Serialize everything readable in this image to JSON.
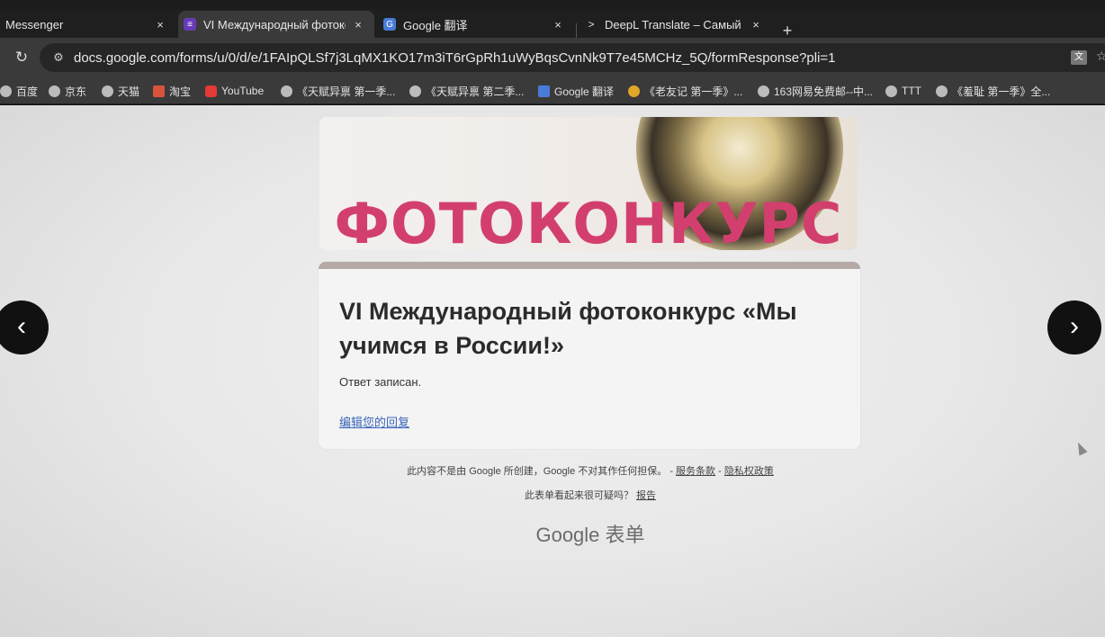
{
  "browser": {
    "tabs": [
      {
        "title": "Messenger",
        "close": "×"
      },
      {
        "title": "VI Международный фотоко",
        "close": "×",
        "active": true
      },
      {
        "title": "Google 翻译",
        "close": "×"
      },
      {
        "title": "DeepL Translate – Самый то",
        "close": "×"
      }
    ],
    "new_tab": "+",
    "url": "docs.google.com/forms/u/0/d/e/1FAIpQLSf7j3LqMX1KO17m3iT6rGpRh1uWyBqsCvnNk9T7e45MCHz_5Q/formResponse?pli=1",
    "bookmarks": [
      "百度",
      "京东",
      "天猫",
      "淘宝",
      "YouTube",
      "《天赋异禀 第一季...",
      "《天赋异禀 第二季...",
      "Google 翻译",
      "《老友记 第一季》...",
      "163网易免费邮--中...",
      "TTT",
      "《羞耻 第一季》全..."
    ]
  },
  "form": {
    "banner_text": "ФОТОКОНКУРС",
    "title": "VI Международный фотоконкурс «Мы учимся в России!»",
    "status": "Ответ записан.",
    "edit_link": "编辑您的回复"
  },
  "footer": {
    "disclaimer": "此内容不是由 Google 所创建，Google 不对其作任何担保。 -",
    "terms": "服务条款",
    "separator": "-",
    "privacy": "隐私权政策",
    "suspicious": "此表单看起来很可疑吗？",
    "report": "报告",
    "logo": "Google 表单"
  },
  "colors": {
    "banner_text": "#d23f6e",
    "card_stripe": "#b5a9a6",
    "link": "#3b66b8"
  }
}
